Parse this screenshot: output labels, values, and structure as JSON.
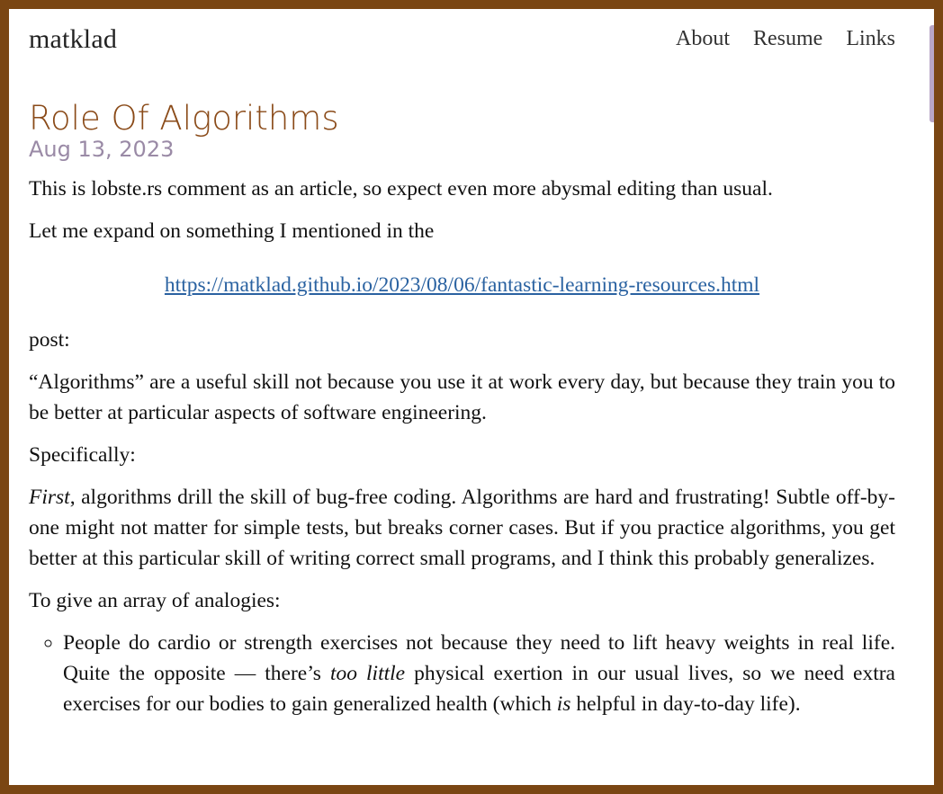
{
  "header": {
    "site_title": "matklad",
    "nav": [
      {
        "label": "About"
      },
      {
        "label": "Resume"
      },
      {
        "label": "Links"
      }
    ]
  },
  "article": {
    "title": "Role Of Algorithms",
    "date": "Aug 13, 2023",
    "p1": "This is lobste.rs comment as an article, so expect even more abysmal editing than usual.",
    "p2": "Let me expand on something I mentioned in the",
    "link": "https://matklad.github.io/2023/08/06/fantastic-learning-resources.html",
    "p3": "post:",
    "p4": "“Algorithms” are a useful skill not because you use it at work every day, but because they train you to be better at particular aspects of software engineering.",
    "p5": "Specifically:",
    "p6_em": "First",
    "p6_rest": ", algorithms drill the skill of bug-free coding. Algorithms are hard and frustrating! Subtle off-by-one might not matter for simple tests, but breaks corner cases. But if you practice algorithms, you get better at this particular skill of writing correct small programs, and I think this probably generalizes.",
    "p7": "To give an array of analogies:",
    "list": [
      {
        "a": "People do cardio or strength exercises not because they need to lift heavy weights in real life. Quite the opposite — there’s ",
        "em1": "too little",
        "b": " physical exertion in our usual lives, so we need extra exercises for our bodies to gain generalized health (which ",
        "em2": "is",
        "c": " helpful in day-to-day life)."
      }
    ]
  },
  "colors": {
    "border": "#7a4613",
    "title": "#8a4a18",
    "date": "#9a8aa6",
    "link": "#2a62a1"
  }
}
